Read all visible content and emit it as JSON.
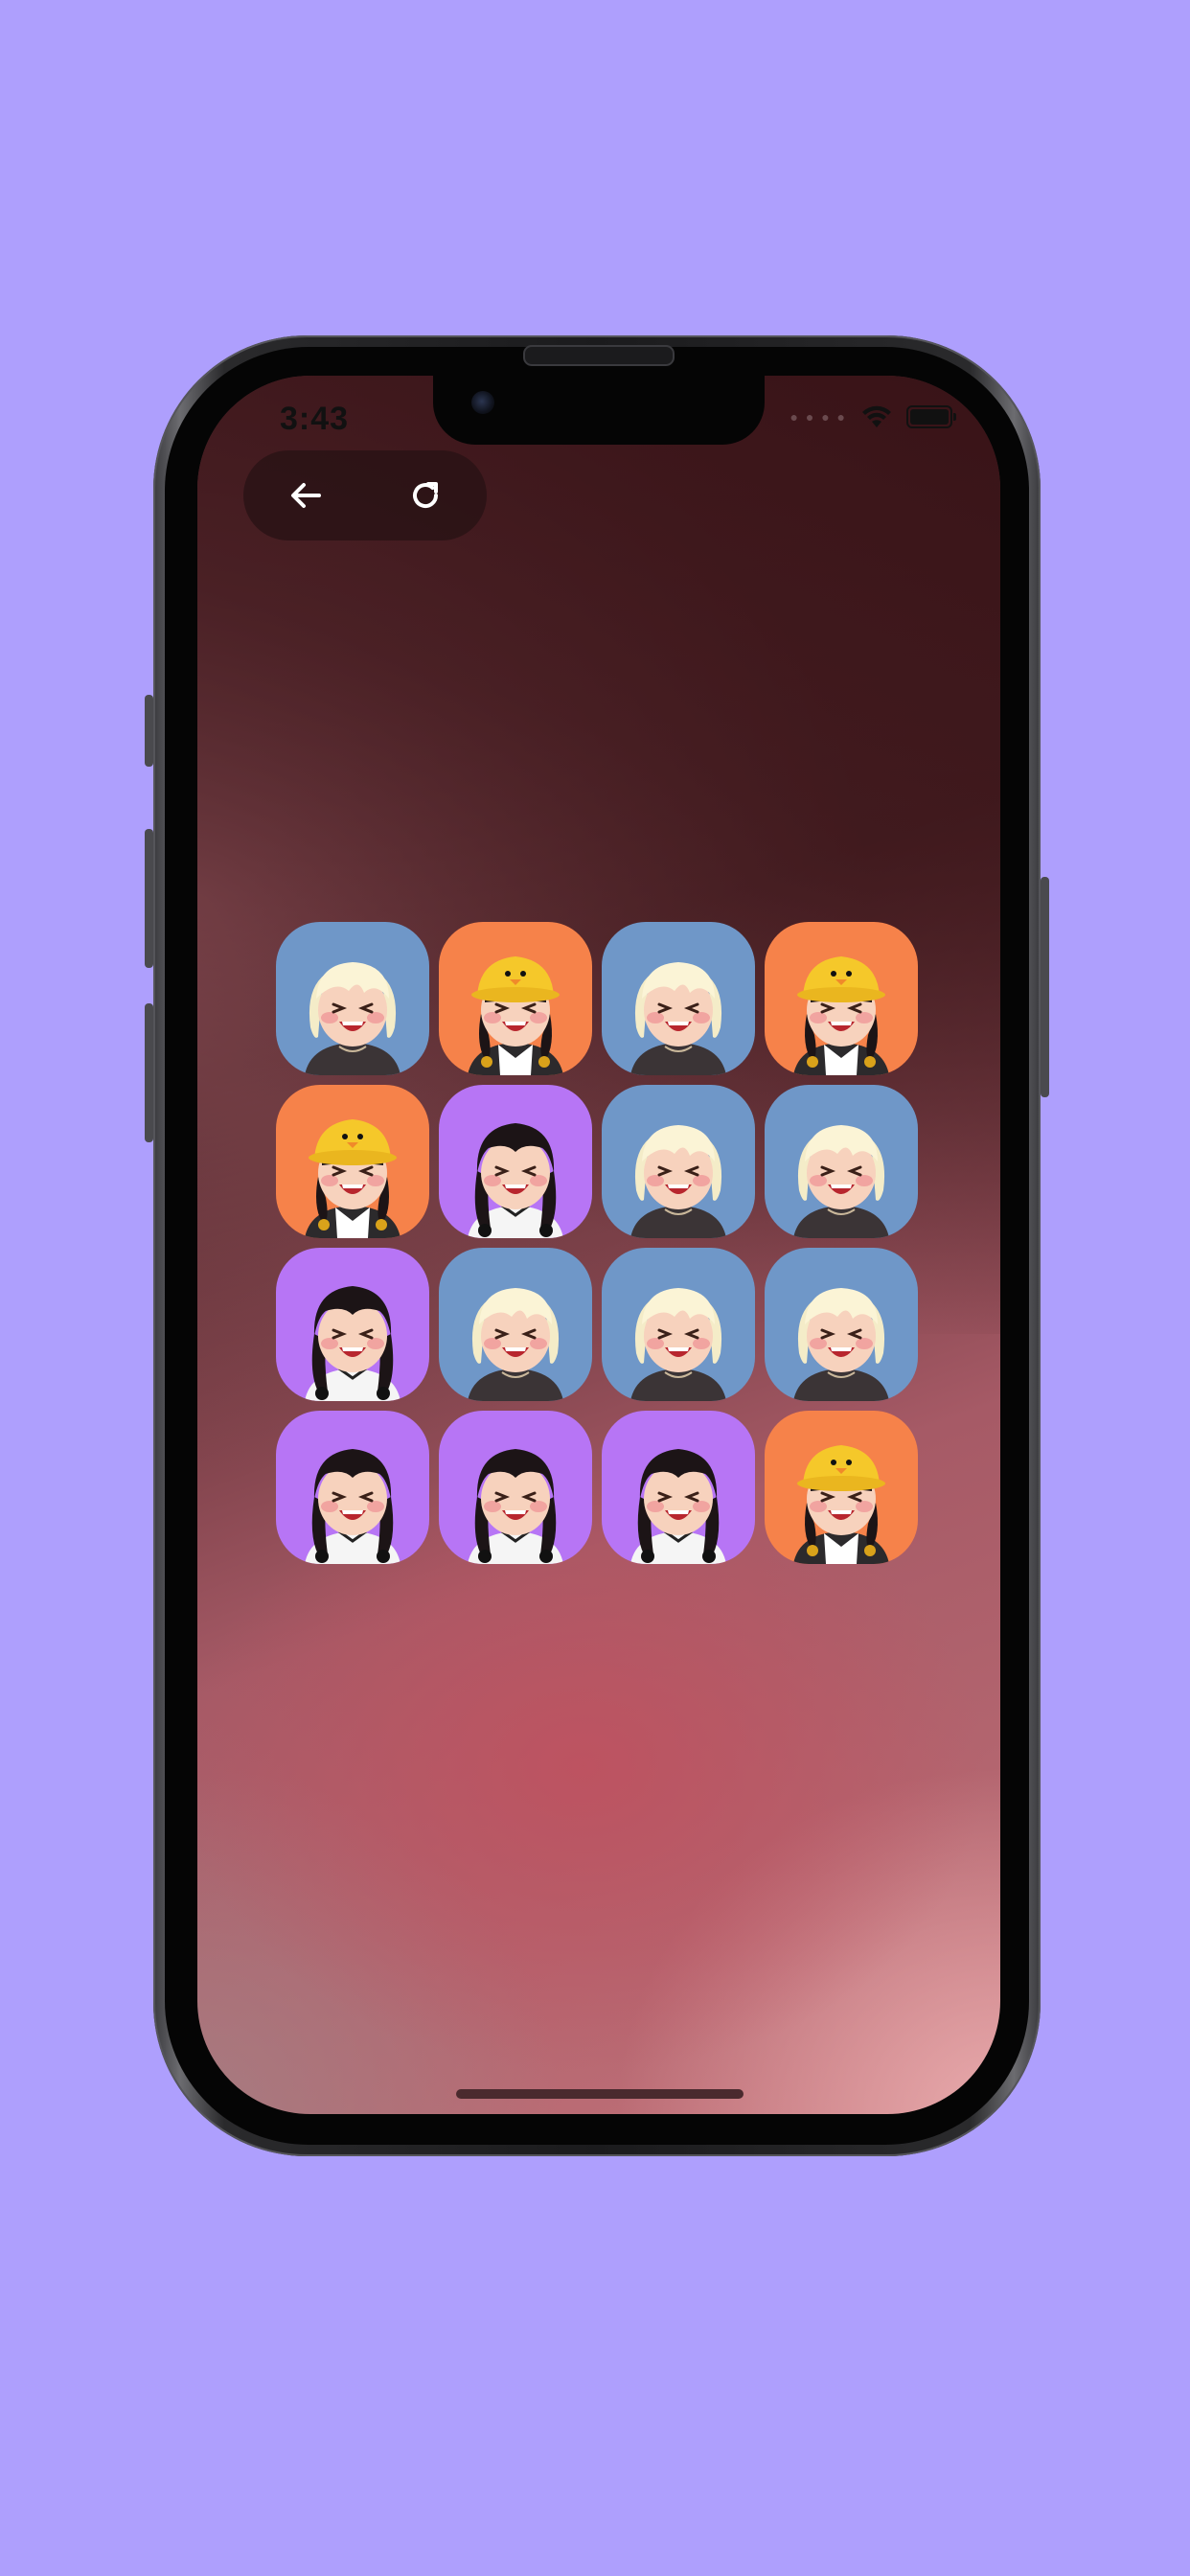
{
  "status_bar": {
    "time": "3:43",
    "wifi_icon": "wifi-icon",
    "battery_icon": "battery-icon"
  },
  "toolbar": {
    "back_icon": "arrow-left-icon",
    "restart_icon": "refresh-icon"
  },
  "colors": {
    "page_background": "#ae9ffd",
    "tile_blonde": "#6f97c8",
    "tile_duck_hat": "#f6824a",
    "tile_black_hair": "#b775f5"
  },
  "board": {
    "rows": [
      [
        "blonde",
        "duck_hat",
        "blonde",
        "duck_hat"
      ],
      [
        "duck_hat",
        "black_hair",
        "blonde",
        "blonde"
      ],
      [
        "black_hair",
        "blonde",
        "blonde",
        "blonde"
      ],
      [
        "black_hair",
        "black_hair",
        "black_hair",
        "duck_hat"
      ]
    ]
  }
}
